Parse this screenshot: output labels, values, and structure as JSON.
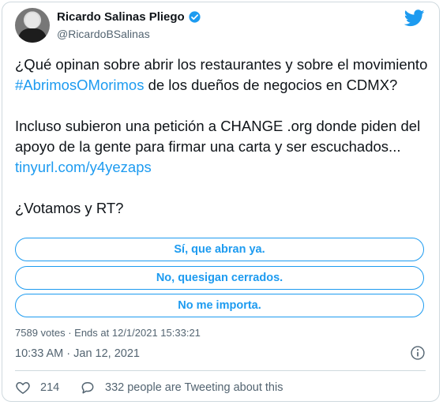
{
  "author": {
    "name": "Ricardo Salinas Pliego",
    "handle": "@RicardoBSalinas"
  },
  "icons": {
    "verified": "verified-badge-icon",
    "brand": "twitter-bird-icon",
    "info": "info-icon",
    "like": "heart-icon",
    "reply": "speech-bubble-icon"
  },
  "colors": {
    "accent": "#1d9bf0",
    "muted": "#536471",
    "text": "#0f1419",
    "border": "#cfd9de"
  },
  "tweet": {
    "line1_prefix": "¿Qué opinan sobre abrir los restaurantes y sobre el movimiento ",
    "hashtag": "#AbrimosOMorimos",
    "line1_suffix": " de los dueños de negocios en CDMX?",
    "para2_text": "Incluso subieron una petición a CHANGE .org donde piden del apoyo de la gente para firmar una carta y ser escuchados... ",
    "link": "tinyurl.com/y4yezaps",
    "para3_text": "¿Votamos y RT?"
  },
  "poll": {
    "options": [
      "Sí, que abran ya.",
      "No, quesigan cerrados.",
      "No me importa."
    ],
    "meta": "7589 votes · Ends at 12/1/2021 15:33:21"
  },
  "timestamp": "10:33 AM · Jan 12, 2021",
  "footer": {
    "likes": "214",
    "reply_text": "332 people are Tweeting about this"
  }
}
